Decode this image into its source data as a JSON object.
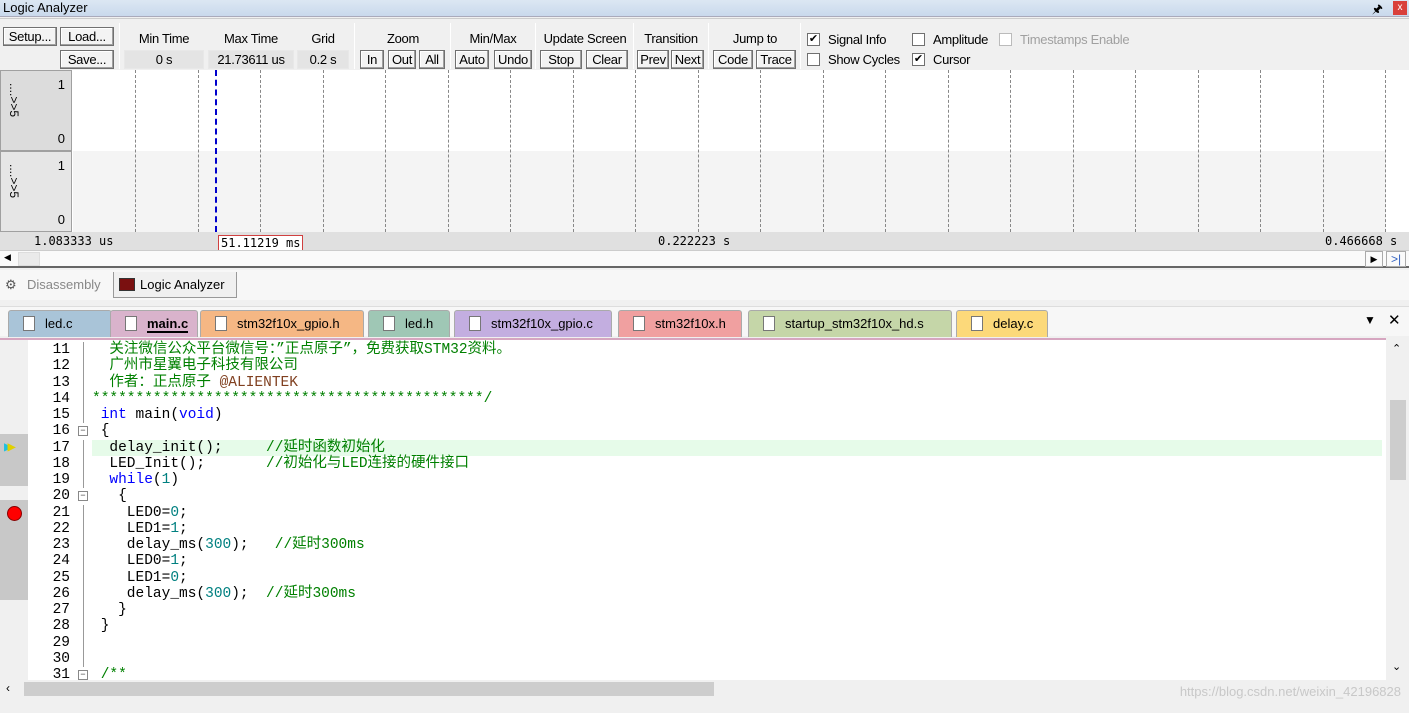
{
  "window": {
    "title": "Logic Analyzer",
    "pin_icon": "pin-icon",
    "close_icon": "close-icon"
  },
  "toolbar": {
    "setup": "Setup...",
    "load": "Load...",
    "save": "Save...",
    "min_time": {
      "label": "Min Time",
      "value": "0 s"
    },
    "max_time": {
      "label": "Max Time",
      "value": "21.73611 us"
    },
    "grid": {
      "label": "Grid",
      "value": "0.2 s"
    },
    "zoom": {
      "label": "Zoom",
      "in": "In",
      "out": "Out",
      "all": "All"
    },
    "minmax": {
      "label": "Min/Max",
      "auto": "Auto",
      "undo": "Undo"
    },
    "update": {
      "label": "Update Screen",
      "stop": "Stop",
      "clear": "Clear"
    },
    "transition": {
      "label": "Transition",
      "prev": "Prev",
      "next": "Next"
    },
    "jump": {
      "label": "Jump to",
      "code": "Code",
      "trace": "Trace"
    },
    "signal_info": {
      "label": "Signal Info",
      "checked": true
    },
    "show_cycles": {
      "label": "Show Cycles",
      "checked": false
    },
    "amplitude": {
      "label": "Amplitude",
      "checked": false
    },
    "cursor": {
      "label": "Cursor",
      "checked": true
    },
    "timestamps": {
      "label": "Timestamps Enable",
      "checked": false,
      "disabled": true
    }
  },
  "signals": [
    {
      "name": "....>>5",
      "high": "1",
      "low": "0"
    },
    {
      "name": "....>>5",
      "high": "1",
      "low": "0"
    }
  ],
  "axis": {
    "left": "1.083333 us",
    "cursor": "51.11219 ms",
    "mid": "0.222223 s",
    "right": "0.466668 s"
  },
  "view_tabs": [
    {
      "label": "Disassembly",
      "active": false
    },
    {
      "label": "Logic Analyzer",
      "active": true
    }
  ],
  "file_tabs": [
    {
      "label": "led.c",
      "color": "#a9c4d8"
    },
    {
      "label": "main.c",
      "color": "#d9b3cc",
      "active": true
    },
    {
      "label": "stm32f10x_gpio.h",
      "color": "#f5b784"
    },
    {
      "label": "led.h",
      "color": "#9fc7b5"
    },
    {
      "label": "stm32f10x_gpio.c",
      "color": "#c3aee0"
    },
    {
      "label": "stm32f10x.h",
      "color": "#f0a0a0"
    },
    {
      "label": "startup_stm32f10x_hd.s",
      "color": "#c5d6a8"
    },
    {
      "label": "delay.c",
      "color": "#fcd97a"
    }
  ],
  "code_lines": [
    {
      "n": "11",
      "t": [
        [
          "  关注微信公众平台微信号：”正点原子”，免费获取STM32资料。",
          "c"
        ]
      ]
    },
    {
      "n": "12",
      "t": [
        [
          "  广州市星翼电子科技有限公司",
          "c"
        ]
      ]
    },
    {
      "n": "13",
      "t": [
        [
          "  作者：正点原子 ",
          "c"
        ],
        [
          "@ALIENTEK",
          "a"
        ]
      ]
    },
    {
      "n": "14",
      "t": [
        [
          "*********************************************/",
          "c"
        ]
      ]
    },
    {
      "n": "15",
      "t": [
        [
          " int",
          "k"
        ],
        [
          " main(",
          "p"
        ],
        [
          "void",
          "k"
        ],
        [
          ")",
          "p"
        ]
      ]
    },
    {
      "n": "16",
      "t": [
        [
          " {",
          "p"
        ]
      ],
      "fold": true
    },
    {
      "n": "17",
      "t": [
        [
          "  delay_init();     ",
          "p"
        ],
        [
          "//延时函数初始化",
          "c"
        ]
      ],
      "current": true
    },
    {
      "n": "18",
      "t": [
        [
          "  LED_Init();       ",
          "p"
        ],
        [
          "//初始化与LED连接的硬件接口",
          "c"
        ]
      ]
    },
    {
      "n": "19",
      "t": [
        [
          "  while",
          "k"
        ],
        [
          "(",
          "p"
        ],
        [
          "1",
          "n"
        ],
        [
          ")",
          "p"
        ]
      ]
    },
    {
      "n": "20",
      "t": [
        [
          "   {",
          "p"
        ]
      ],
      "fold": true
    },
    {
      "n": "21",
      "t": [
        [
          "    LED0=",
          "p"
        ],
        [
          "0",
          "n"
        ],
        [
          ";",
          "p"
        ]
      ],
      "breakpoint": true
    },
    {
      "n": "22",
      "t": [
        [
          "    LED1=",
          "p"
        ],
        [
          "1",
          "n"
        ],
        [
          ";",
          "p"
        ]
      ]
    },
    {
      "n": "23",
      "t": [
        [
          "    delay_ms(",
          "p"
        ],
        [
          "300",
          "n"
        ],
        [
          ");   ",
          "p"
        ],
        [
          "//延时300ms",
          "c"
        ]
      ]
    },
    {
      "n": "24",
      "t": [
        [
          "    LED0=",
          "p"
        ],
        [
          "1",
          "n"
        ],
        [
          ";",
          "p"
        ]
      ]
    },
    {
      "n": "25",
      "t": [
        [
          "    LED1=",
          "p"
        ],
        [
          "0",
          "n"
        ],
        [
          ";",
          "p"
        ]
      ]
    },
    {
      "n": "26",
      "t": [
        [
          "    delay_ms(",
          "p"
        ],
        [
          "300",
          "n"
        ],
        [
          ");  ",
          "p"
        ],
        [
          "//延时300ms",
          "c"
        ]
      ]
    },
    {
      "n": "27",
      "t": [
        [
          "   }",
          "p"
        ]
      ]
    },
    {
      "n": "28",
      "t": [
        [
          " }",
          "p"
        ]
      ]
    },
    {
      "n": "29",
      "t": []
    },
    {
      "n": "30",
      "t": []
    },
    {
      "n": "31",
      "t": [
        [
          " /**",
          "c"
        ]
      ],
      "fold": true
    }
  ],
  "watermark": "https://blog.csdn.net/weixin_42196828",
  "colors": {
    "current_line": "#e6fbe9",
    "breakpoint": "#ff0000",
    "cursor": "#0000cc"
  }
}
